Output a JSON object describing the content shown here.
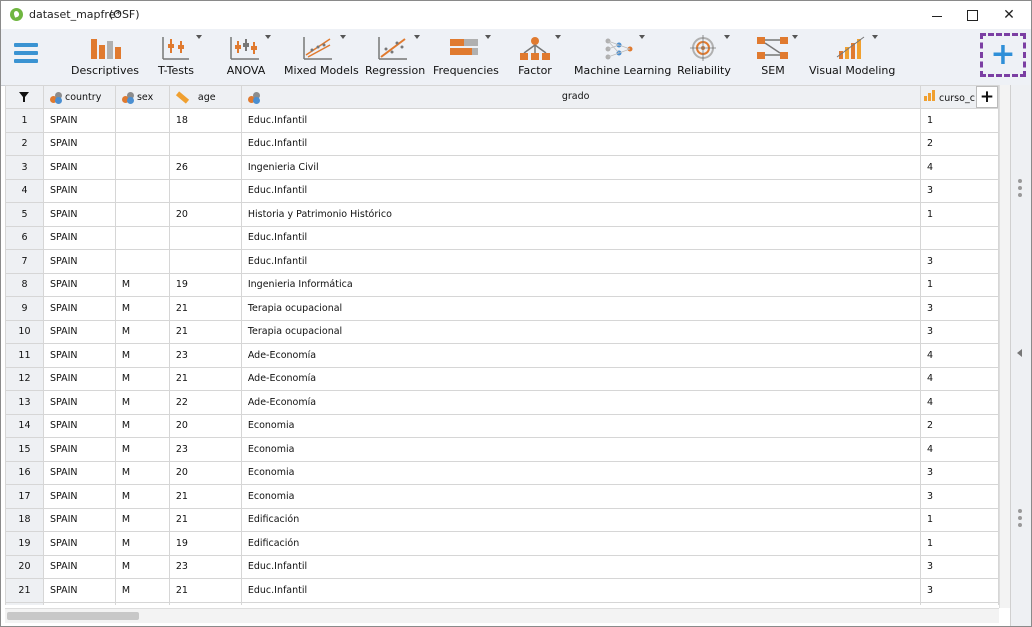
{
  "window": {
    "title": "dataset_mapfre*",
    "suffix": "(OSF)"
  },
  "ribbon": {
    "items": [
      {
        "label": "Descriptives",
        "icon": "descriptives-icon"
      },
      {
        "label": "T-Tests",
        "icon": "ttests-icon"
      },
      {
        "label": "ANOVA",
        "icon": "anova-icon"
      },
      {
        "label": "Mixed Models",
        "icon": "mixed-models-icon"
      },
      {
        "label": "Regression",
        "icon": "regression-icon"
      },
      {
        "label": "Frequencies",
        "icon": "frequencies-icon"
      },
      {
        "label": "Factor",
        "icon": "factor-icon"
      },
      {
        "label": "Machine Learning",
        "icon": "machine-learning-icon"
      },
      {
        "label": "Reliability",
        "icon": "reliability-icon"
      },
      {
        "label": "SEM",
        "icon": "sem-icon"
      },
      {
        "label": "Visual Modeling",
        "icon": "visual-modeling-icon"
      }
    ],
    "add_module": "+"
  },
  "table": {
    "columns": [
      "country",
      "sex",
      "age",
      "grado",
      "curso_c"
    ],
    "rows": [
      [
        "1",
        "SPAIN",
        "",
        "18",
        "Educ.Infantil",
        "1"
      ],
      [
        "2",
        "SPAIN",
        "",
        "",
        "Educ.Infantil",
        "2"
      ],
      [
        "3",
        "SPAIN",
        "",
        "26",
        "Ingenieria Civil",
        "4"
      ],
      [
        "4",
        "SPAIN",
        "",
        "",
        "Educ.Infantil",
        "3"
      ],
      [
        "5",
        "SPAIN",
        "",
        "20",
        "Historia y Patrimonio Histórico",
        "1"
      ],
      [
        "6",
        "SPAIN",
        "",
        "",
        "Educ.Infantil",
        ""
      ],
      [
        "7",
        "SPAIN",
        "",
        "",
        "Educ.Infantil",
        "3"
      ],
      [
        "8",
        "SPAIN",
        "M",
        "19",
        "Ingenieria Informática",
        "1"
      ],
      [
        "9",
        "SPAIN",
        "M",
        "21",
        "Terapia ocupacional",
        "3"
      ],
      [
        "10",
        "SPAIN",
        "M",
        "21",
        "Terapia ocupacional",
        "3"
      ],
      [
        "11",
        "SPAIN",
        "M",
        "23",
        "Ade-Economía",
        "4"
      ],
      [
        "12",
        "SPAIN",
        "M",
        "21",
        "Ade-Economía",
        "4"
      ],
      [
        "13",
        "SPAIN",
        "M",
        "22",
        "Ade-Economía",
        "4"
      ],
      [
        "14",
        "SPAIN",
        "M",
        "20",
        "Economia",
        "2"
      ],
      [
        "15",
        "SPAIN",
        "M",
        "23",
        "Economia",
        "4"
      ],
      [
        "16",
        "SPAIN",
        "M",
        "20",
        "Economia",
        "3"
      ],
      [
        "17",
        "SPAIN",
        "M",
        "21",
        "Economia",
        "3"
      ],
      [
        "18",
        "SPAIN",
        "M",
        "21",
        "Edificación",
        "1"
      ],
      [
        "19",
        "SPAIN",
        "M",
        "19",
        "Edificación",
        "1"
      ],
      [
        "20",
        "SPAIN",
        "M",
        "23",
        "Educ.Infantil",
        "3"
      ],
      [
        "21",
        "SPAIN",
        "M",
        "21",
        "Educ.Infantil",
        "3"
      ],
      [
        "",
        "",
        "",
        "",
        "",
        ""
      ]
    ]
  },
  "colors": {
    "accent": "#3a93d2",
    "highlight": "#7b3fa3",
    "orange": "#e07a2f"
  }
}
